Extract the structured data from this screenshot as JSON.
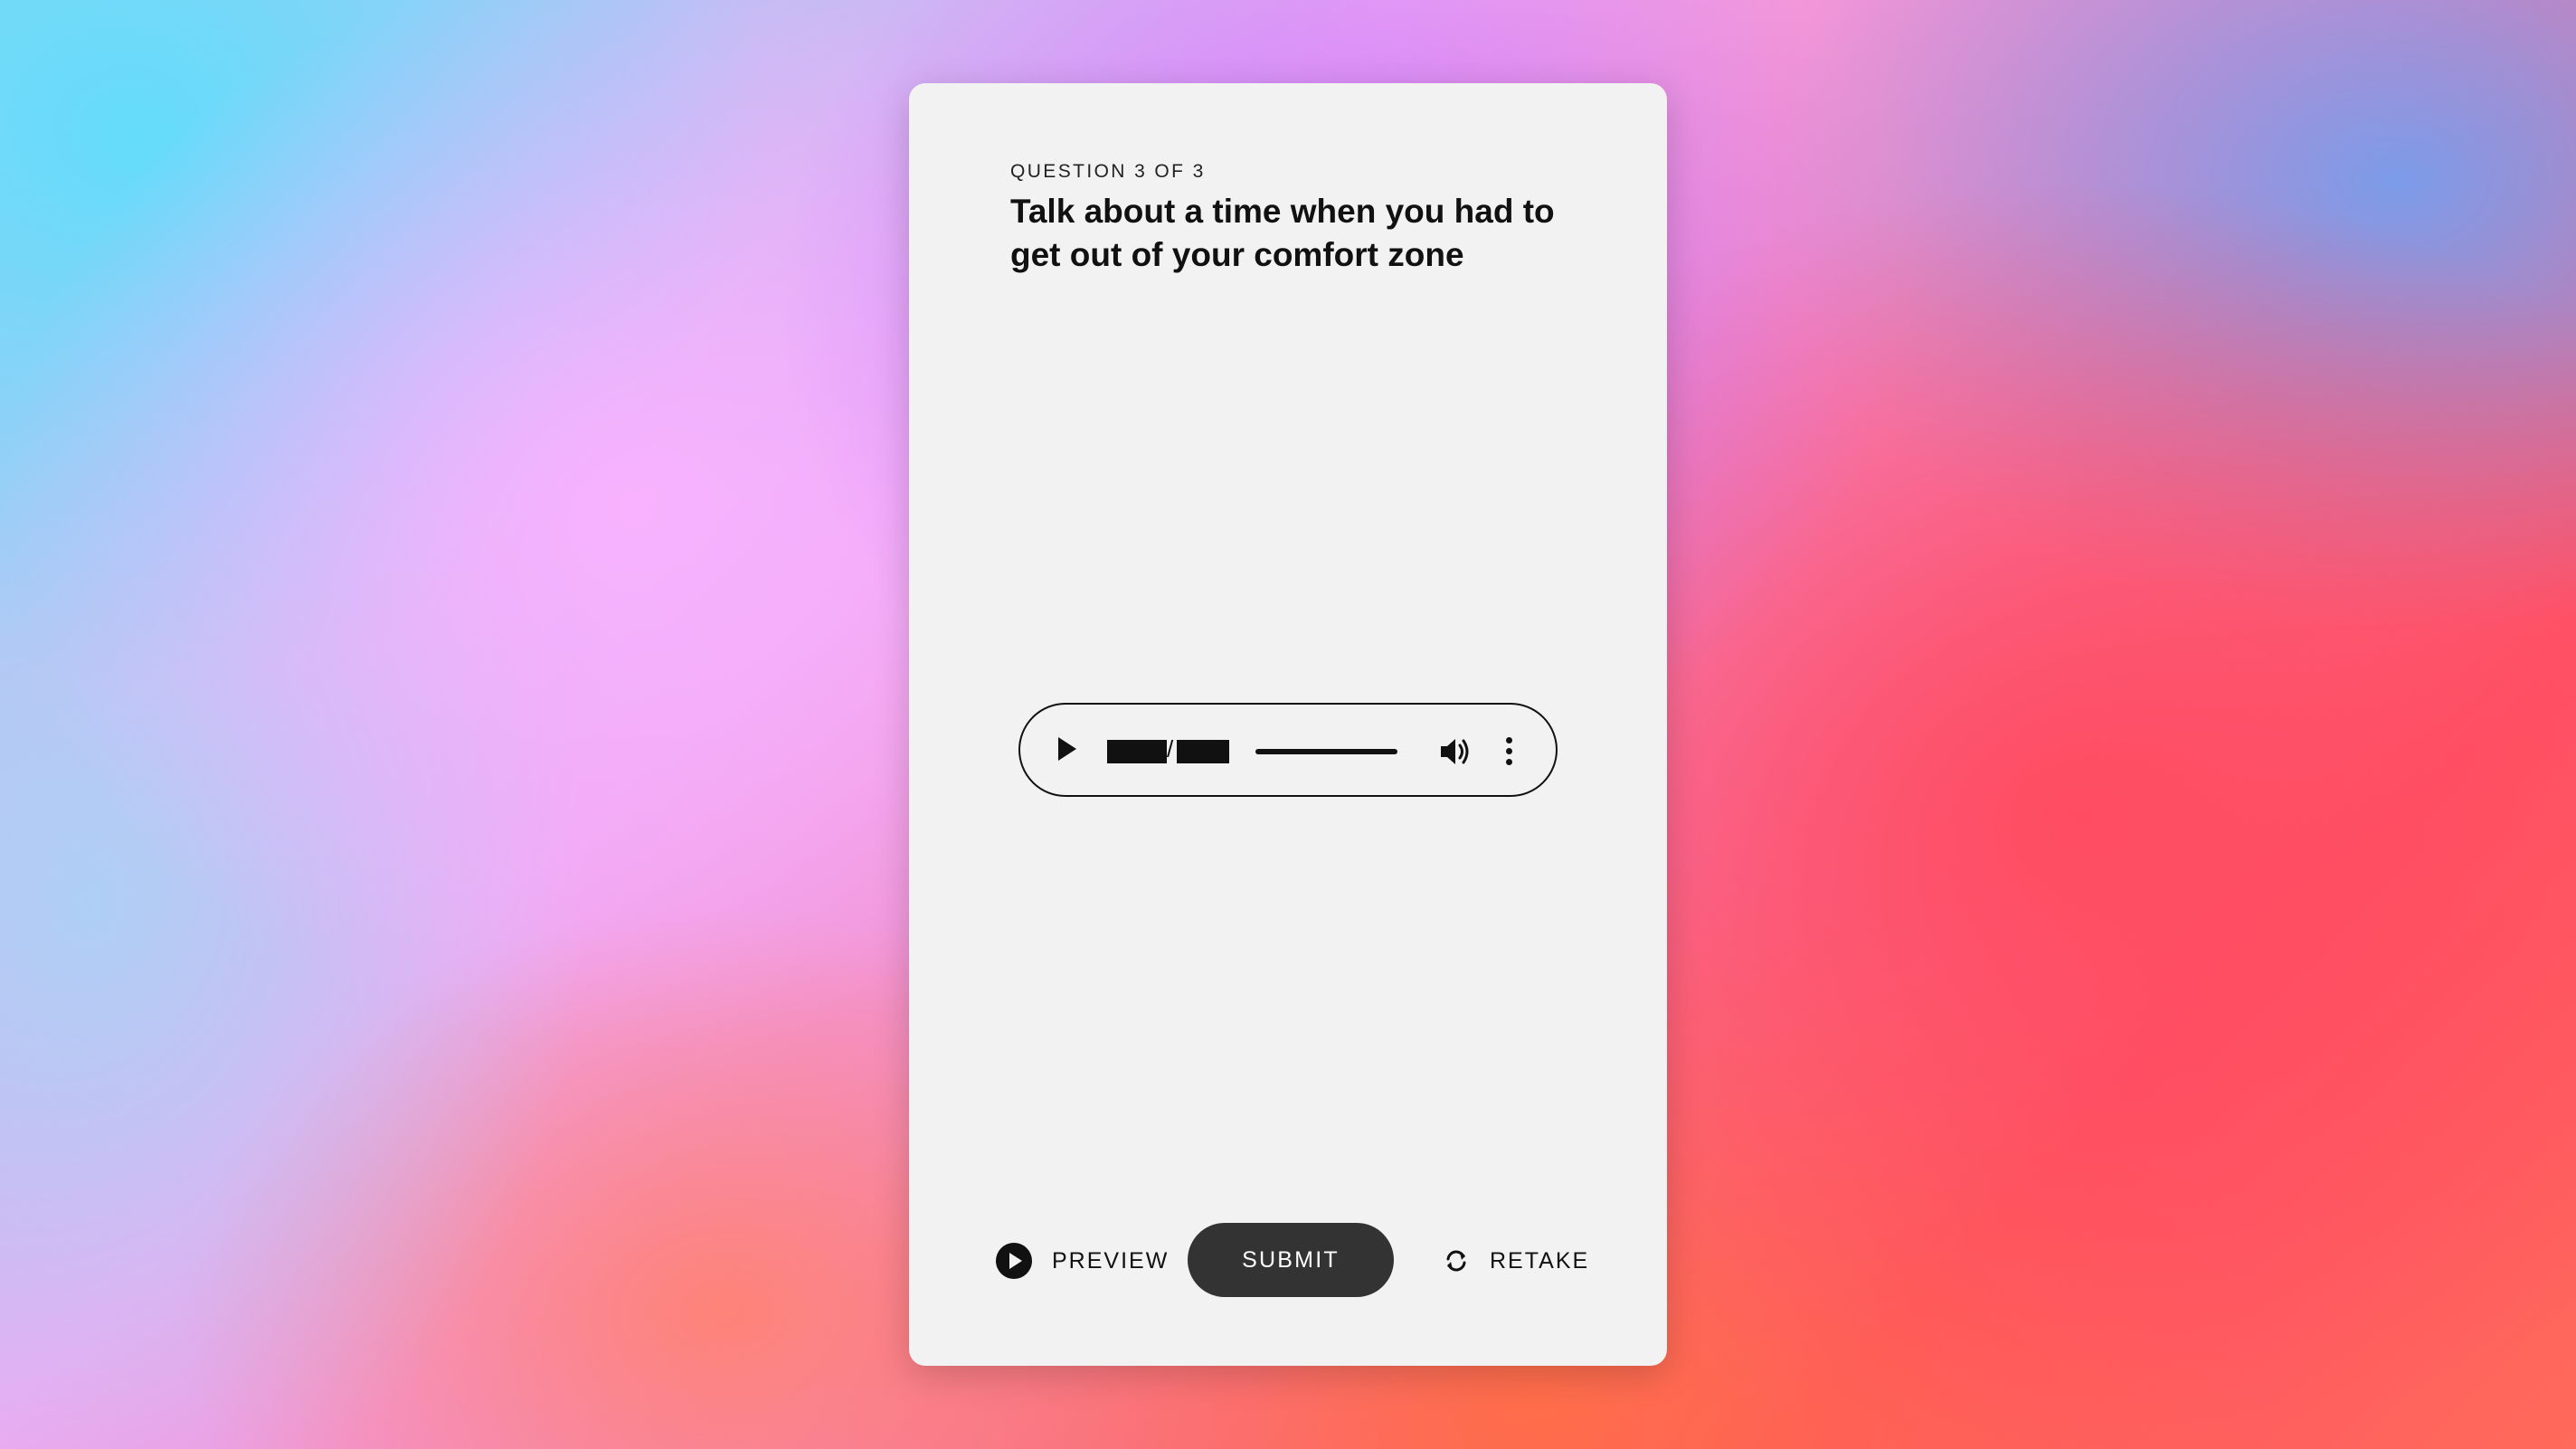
{
  "question": {
    "counter": "QUESTION 3 OF 3",
    "title": "Talk about a time when you had to get out of your comfort zone"
  },
  "player": {
    "icons": [
      "play-icon",
      "volume-icon",
      "more-vertical-icon"
    ],
    "time_separator": "/"
  },
  "actions": {
    "preview_label": "PREVIEW",
    "submit_label": "SUBMIT",
    "retake_label": "RETAKE"
  },
  "colors": {
    "card_bg": "#f2f2f2",
    "submit_bg": "#333333",
    "text": "#111111"
  }
}
